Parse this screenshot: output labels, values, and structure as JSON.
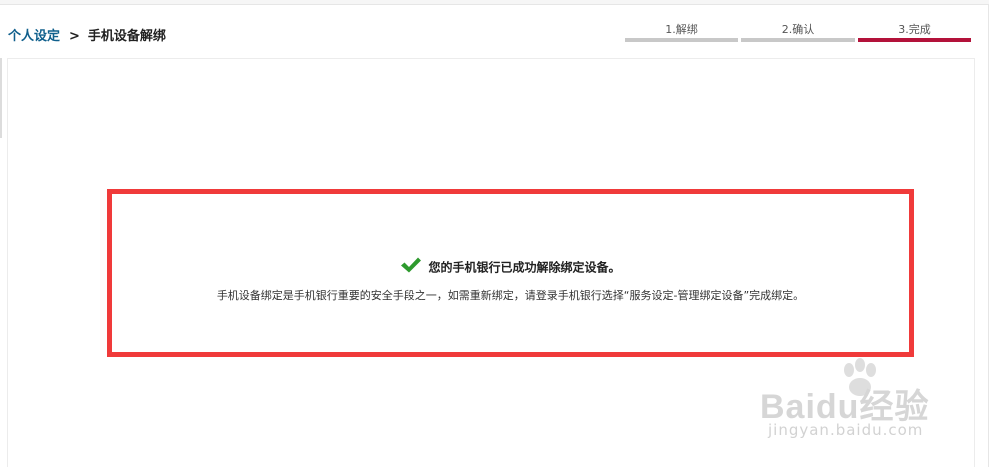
{
  "breadcrumb": {
    "parent": "个人设定",
    "separator": ">",
    "current": "手机设备解绑"
  },
  "steps": [
    {
      "label": "1.解绑",
      "active": false
    },
    {
      "label": "2.确认",
      "active": false
    },
    {
      "label": "3.完成",
      "active": true
    }
  ],
  "result": {
    "icon": "check-icon",
    "title": "您的手机银行已成功解除绑定设备。",
    "description": "手机设备绑定是手机银行重要的安全手段之一，如需重新绑定，请登录手机银行选择“服务设定-管理绑定设备”完成绑定。"
  },
  "watermark": {
    "brand": "Baidu经验",
    "url": "jingyan.baidu.com"
  },
  "colors": {
    "link": "#0f5f8c",
    "step_active": "#b3123a",
    "step_inactive": "#c8c8c8",
    "highlight_border": "#f03a3a",
    "check": "#2e9a2e"
  }
}
